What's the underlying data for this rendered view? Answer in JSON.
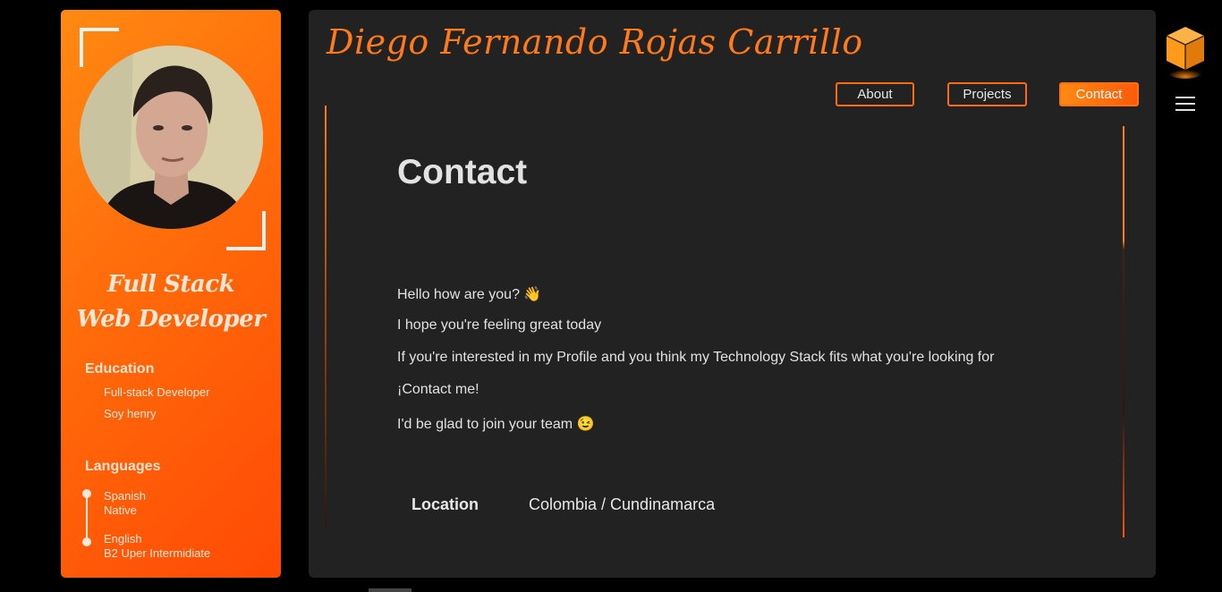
{
  "sidebar": {
    "role_line1": "Full Stack",
    "role_line2": "Web Developer",
    "education_title": "Education",
    "education_items": [
      "Full-stack Developer",
      "Soy henry"
    ],
    "languages_title": "Languages",
    "languages": [
      {
        "name": "Spanish",
        "level": "Native"
      },
      {
        "name": "English",
        "level": "B2 Uper Intermidiate"
      }
    ]
  },
  "header": {
    "title": "Diego Fernando Rojas Carrillo",
    "nav": [
      "About",
      "Projects",
      "Contact"
    ],
    "active_nav": "Contact"
  },
  "main": {
    "heading": "Contact",
    "paragraphs": [
      "Hello how are you? 👋",
      "I hope you're feeling great today",
      "If you're interested in my Profile and you think my Technology Stack fits what you're looking for",
      "¡Contact me!",
      "I'd be glad to join your team 😉"
    ],
    "location_label": "Location",
    "location_value": "Colombia / Cundinamarca"
  },
  "icons": {
    "cube": "cube-icon",
    "menu": "hamburger-menu-icon"
  },
  "colors": {
    "accent": "#ff6a0a",
    "panel": "#222222",
    "background": "#000000"
  }
}
